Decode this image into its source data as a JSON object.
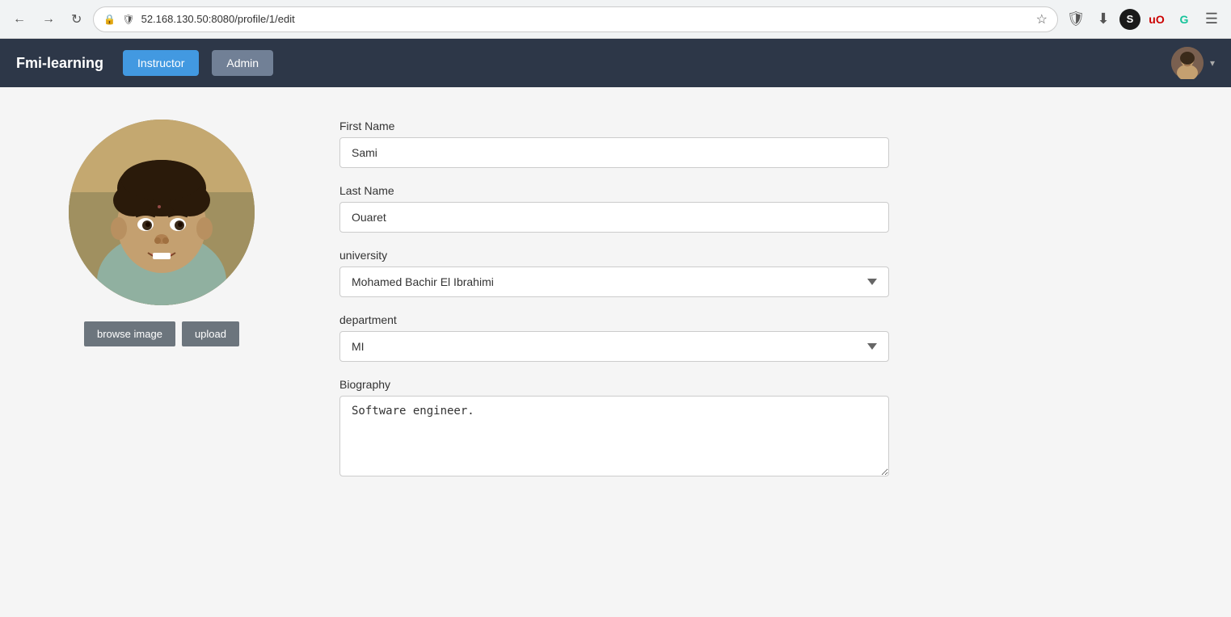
{
  "browser": {
    "back_label": "←",
    "forward_label": "→",
    "refresh_label": "↻",
    "url": "52.168.130.50:8080/profile/1/edit",
    "url_prefix": "52.168.130.50",
    "url_suffix": ":8080/profile/1/edit",
    "star_label": "☆",
    "shield_label": "🛡",
    "download_label": "⬇",
    "s_icon_label": "S",
    "extension1_label": "🛡",
    "grammarly_label": "G",
    "menu_label": "☰"
  },
  "navbar": {
    "brand": "Fmi-learning",
    "instructor_label": "Instructor",
    "admin_label": "Admin",
    "dropdown_arrow": "▾"
  },
  "form": {
    "first_name_label": "First Name",
    "first_name_value": "Sami",
    "first_name_placeholder": "First Name",
    "last_name_label": "Last Name",
    "last_name_value": "Ouaret",
    "last_name_placeholder": "Last Name",
    "university_label": "university",
    "university_value": "Mohamed Bachir El Ibrahimi",
    "university_options": [
      "Mohamed Bachir El Ibrahimi"
    ],
    "department_label": "department",
    "department_value": "MI",
    "department_options": [
      "MI"
    ],
    "biography_label": "Biography",
    "biography_value": "Software engineer."
  },
  "image_buttons": {
    "browse_label": "browse image",
    "upload_label": "upload"
  }
}
